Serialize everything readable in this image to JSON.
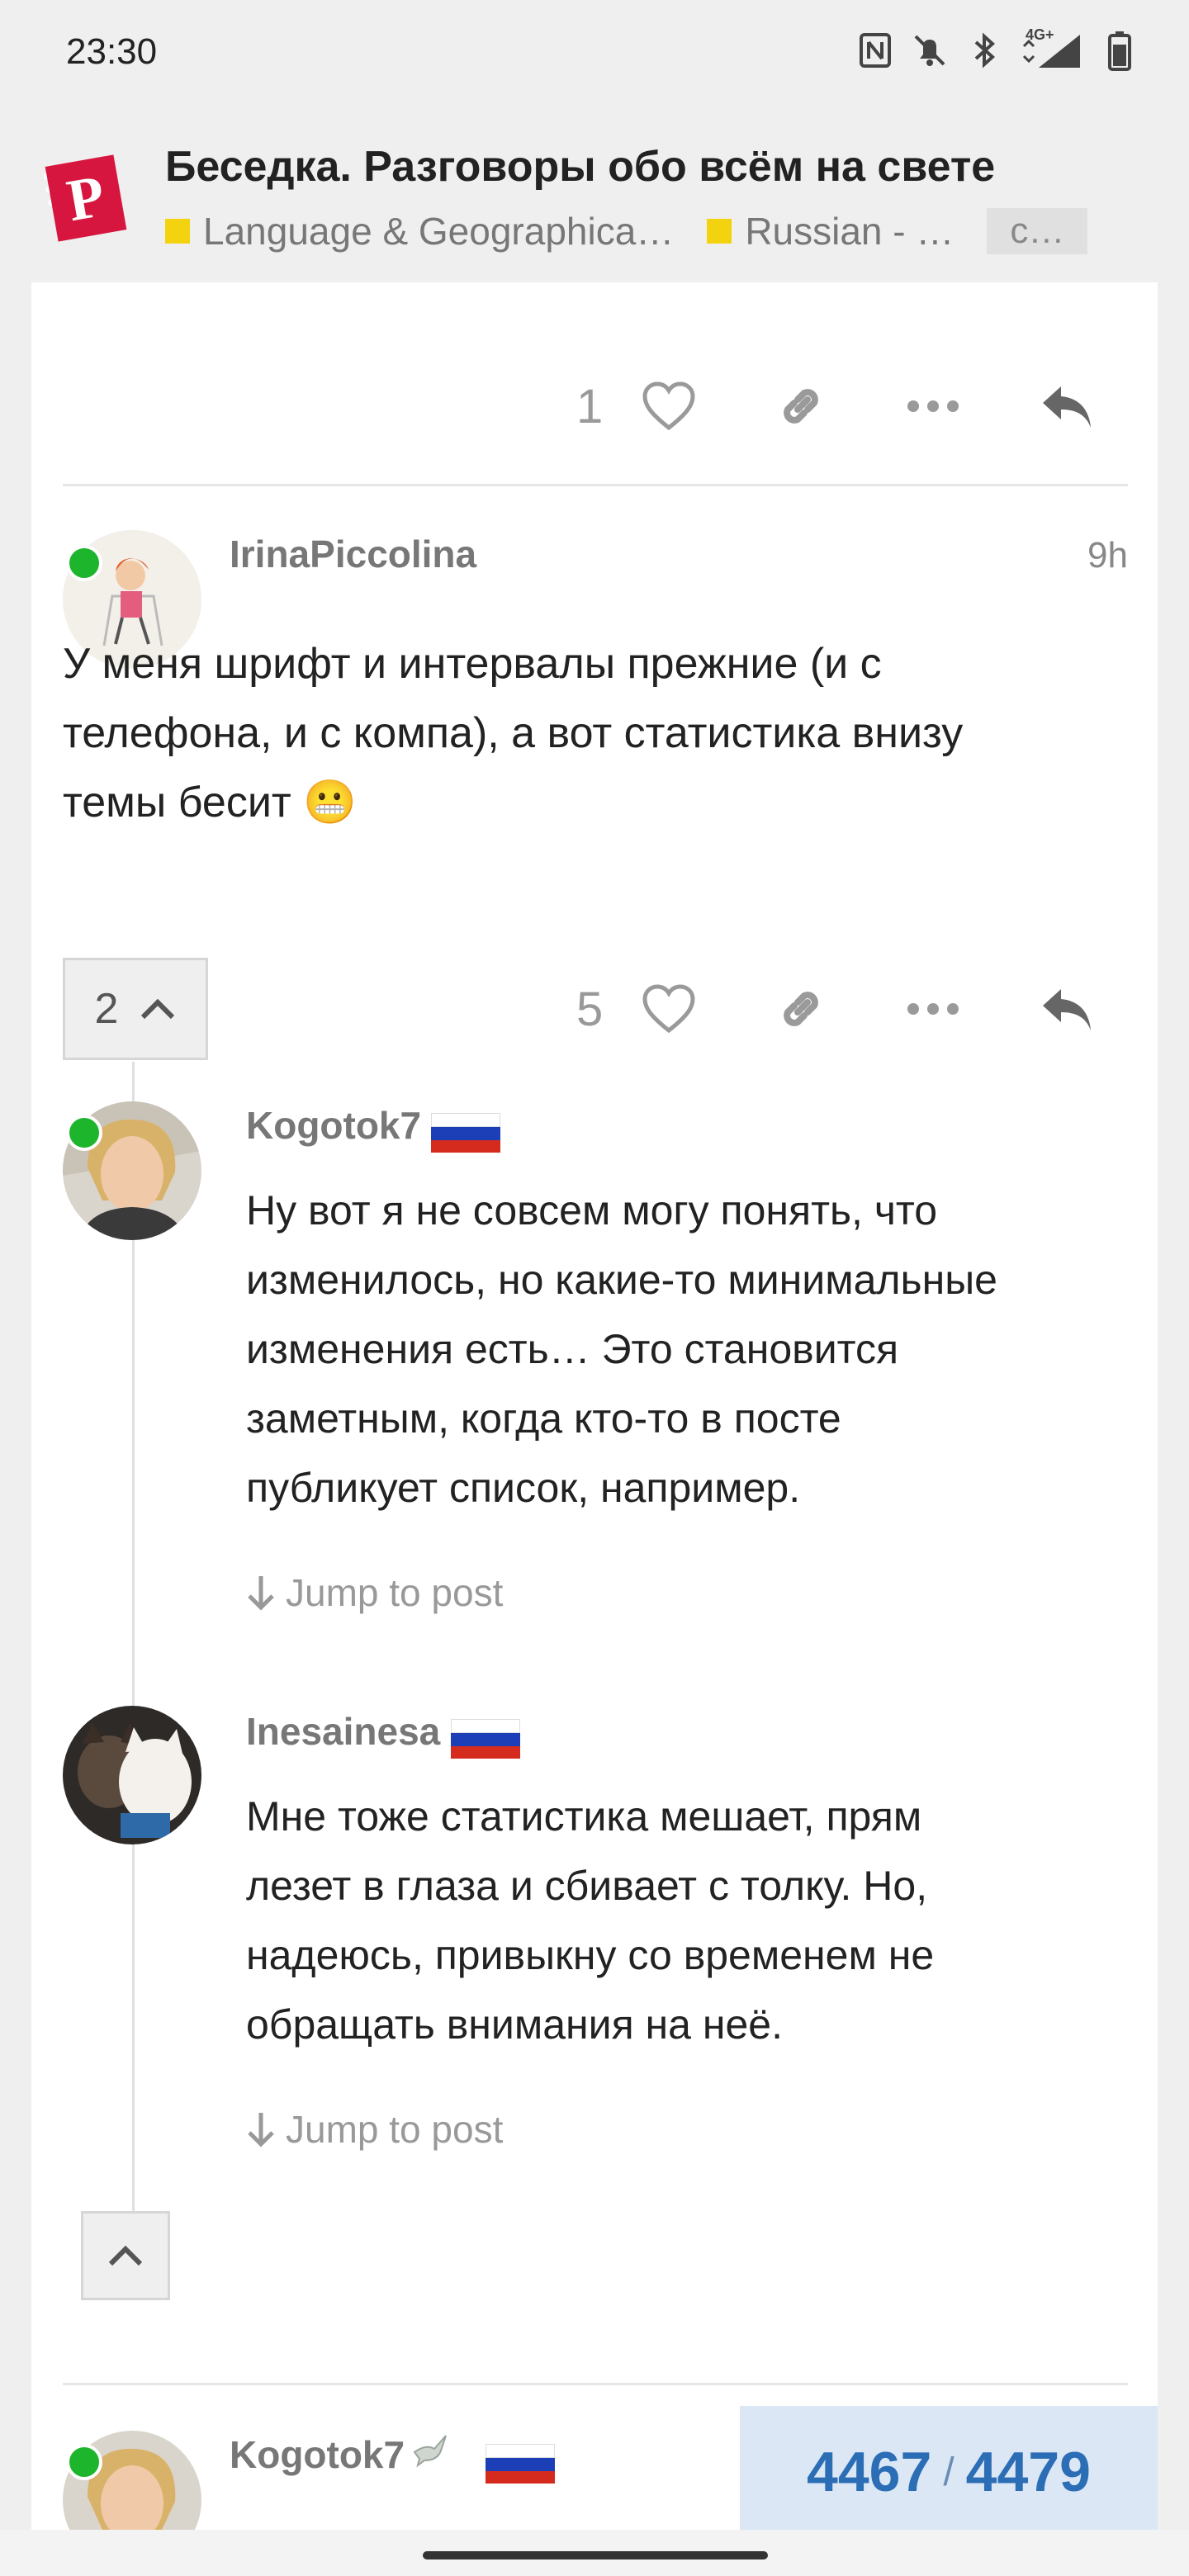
{
  "status_bar": {
    "time": "23:30",
    "icons": [
      "nfc-icon",
      "do-not-disturb-icon",
      "bluetooth-icon",
      "4g-signal-icon",
      "battery-icon"
    ],
    "network_label": "4G+"
  },
  "header": {
    "title": "Беседка. Разговоры обо всём на свете",
    "breadcrumbs": [
      {
        "label": "Language & Geographica…",
        "color": "#f3d20f"
      },
      {
        "label": "Russian - …",
        "color": "#f3d20f"
      }
    ],
    "more_label": "c…"
  },
  "top_post_actions": {
    "like_count": "1"
  },
  "post": {
    "username": "IrinaPiccolina",
    "time_ago": "9h",
    "text_lines": [
      "У меня шрифт и интервалы прежние (и с",
      "телефона, и с компа), а вот статистика внизу",
      "темы бесит 😬"
    ],
    "replies_count": "2",
    "like_count": "5"
  },
  "replies": [
    {
      "username": "Kogotok7",
      "text_lines": [
        "Ну вот я не совсем могу понять, что",
        "изменилось, но какие-то минимальные",
        "изменения есть… Это становится",
        "заметным, когда кто-то в посте",
        "публикует список, например."
      ],
      "jump_label": "Jump to post"
    },
    {
      "username": "Inesainesa",
      "text_lines": [
        "Мне тоже статистика мешает, прям",
        "лезет в глаза и сбивает с толку. Но,",
        "надеюсь, привыкну со временем не",
        "обращать внимания на неё."
      ],
      "jump_label": "Jump to post"
    }
  ],
  "next_post": {
    "username": "Kogotok7"
  },
  "progress": {
    "current": "4467",
    "separator": "/",
    "total": "4479"
  },
  "colors": {
    "online": "#1db52b",
    "progress_text": "#2c6eb6",
    "category": "#f3d20f",
    "logo": "#d6163f"
  }
}
